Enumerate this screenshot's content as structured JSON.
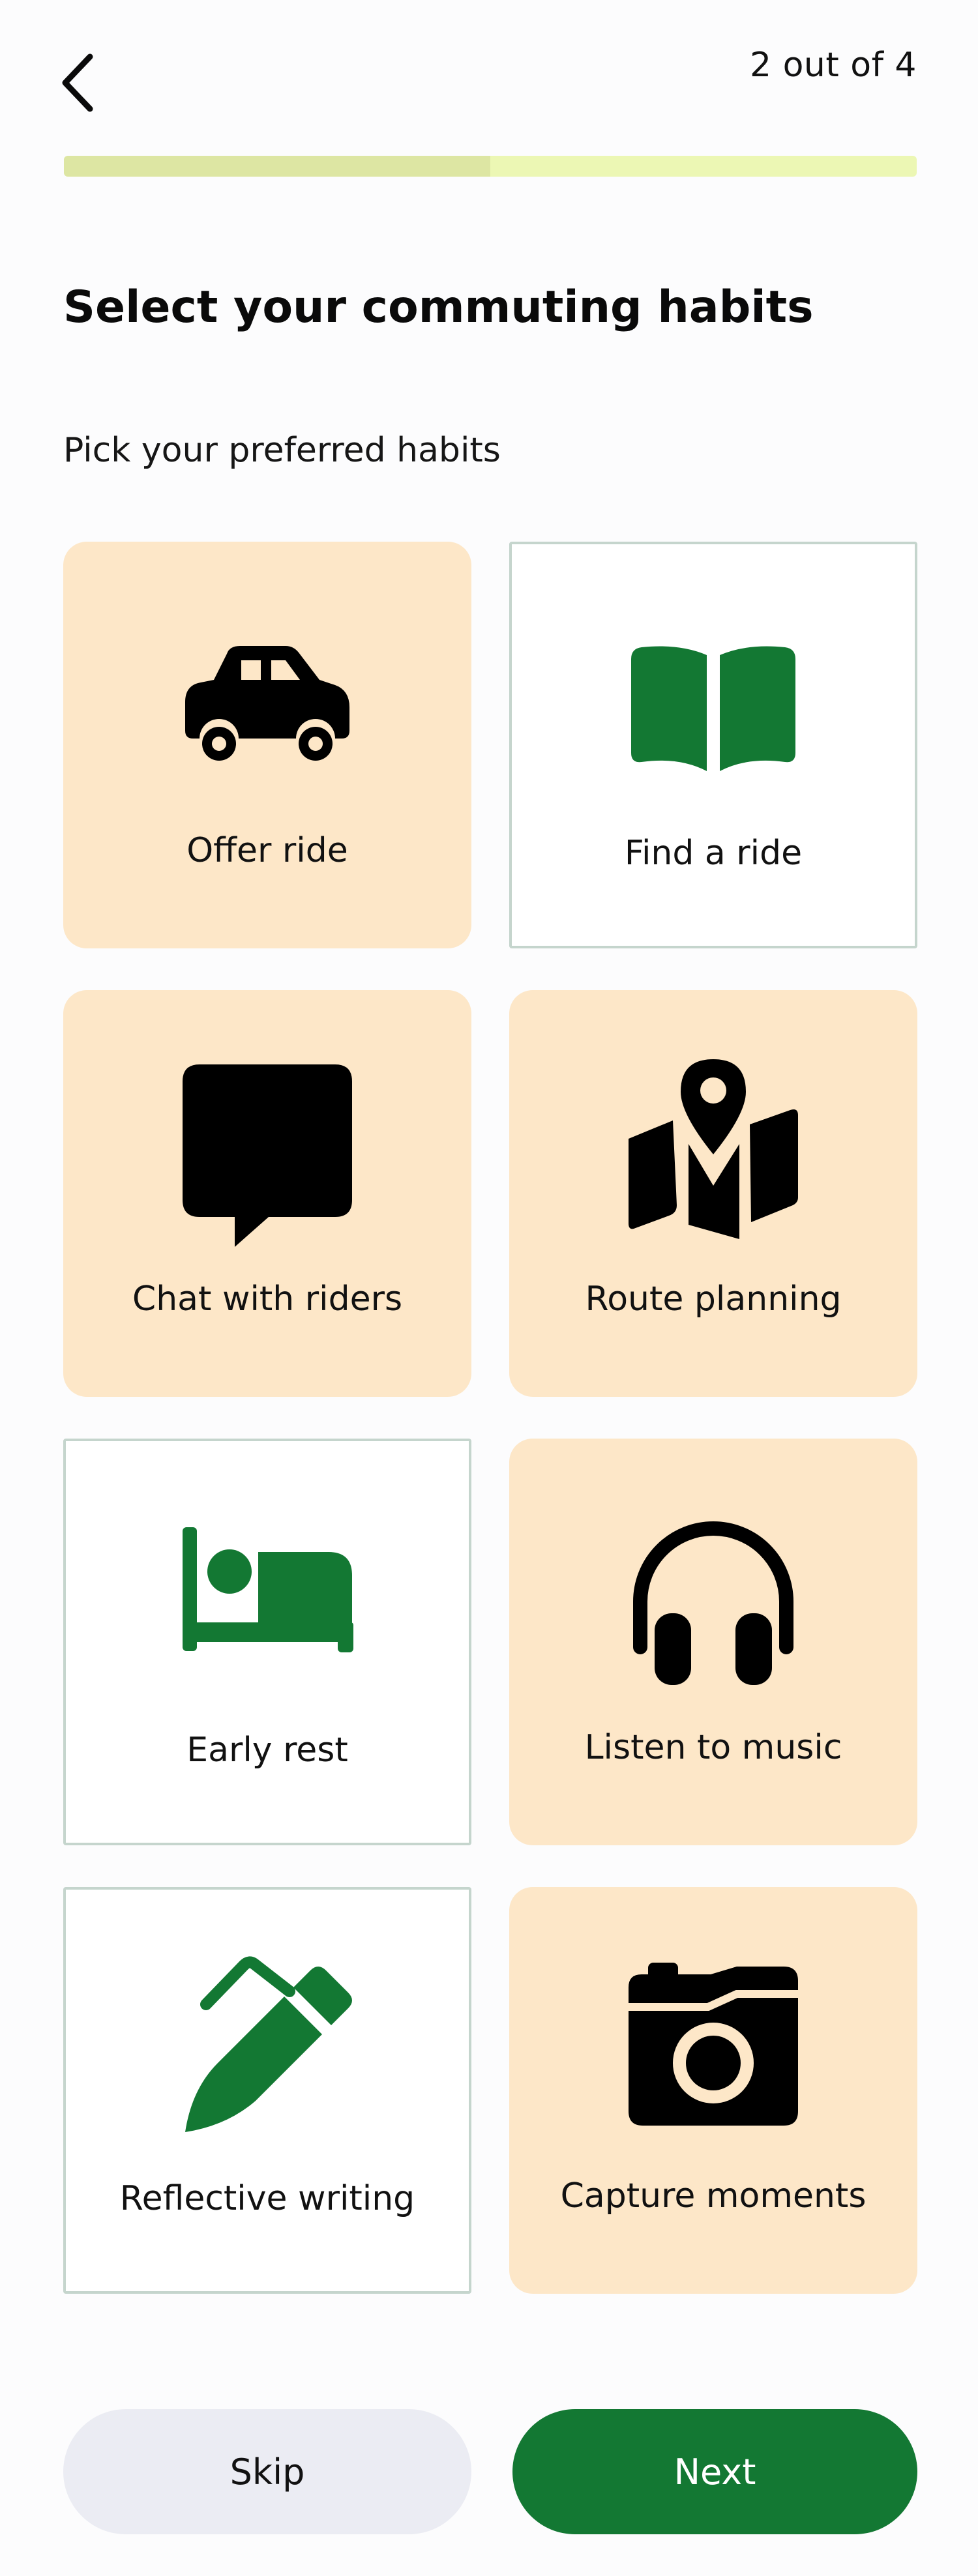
{
  "header": {
    "back_icon": "chevron-left-icon",
    "step_text": "2 out of 4",
    "progress": 0.5,
    "progress_track_color": "#ecf7b4",
    "progress_fill_color": "#dde6a3"
  },
  "title": "Select your commuting habits",
  "subtitle": "Pick your preferred habits",
  "colors": {
    "card_unselected_bg": "#fde7c8",
    "card_selected_border": "#c5d5cd",
    "selected_icon": "#137833",
    "accent": "#137833"
  },
  "habits": [
    {
      "label": "Offer ride",
      "icon": "car-icon",
      "selected": false
    },
    {
      "label": "Find a ride",
      "icon": "open-book-icon",
      "selected": true
    },
    {
      "label": "Chat with riders",
      "icon": "chat-bubble-icon",
      "selected": false
    },
    {
      "label": "Route planning",
      "icon": "map-pin-icon",
      "selected": false
    },
    {
      "label": "Early rest",
      "icon": "bed-icon",
      "selected": true
    },
    {
      "label": "Listen to music",
      "icon": "headphones-icon",
      "selected": false
    },
    {
      "label": "Reflective writing",
      "icon": "pen-icon",
      "selected": true
    },
    {
      "label": "Capture moments",
      "icon": "camera-icon",
      "selected": false
    }
  ],
  "footer": {
    "skip_label": "Skip",
    "next_label": "Next"
  }
}
